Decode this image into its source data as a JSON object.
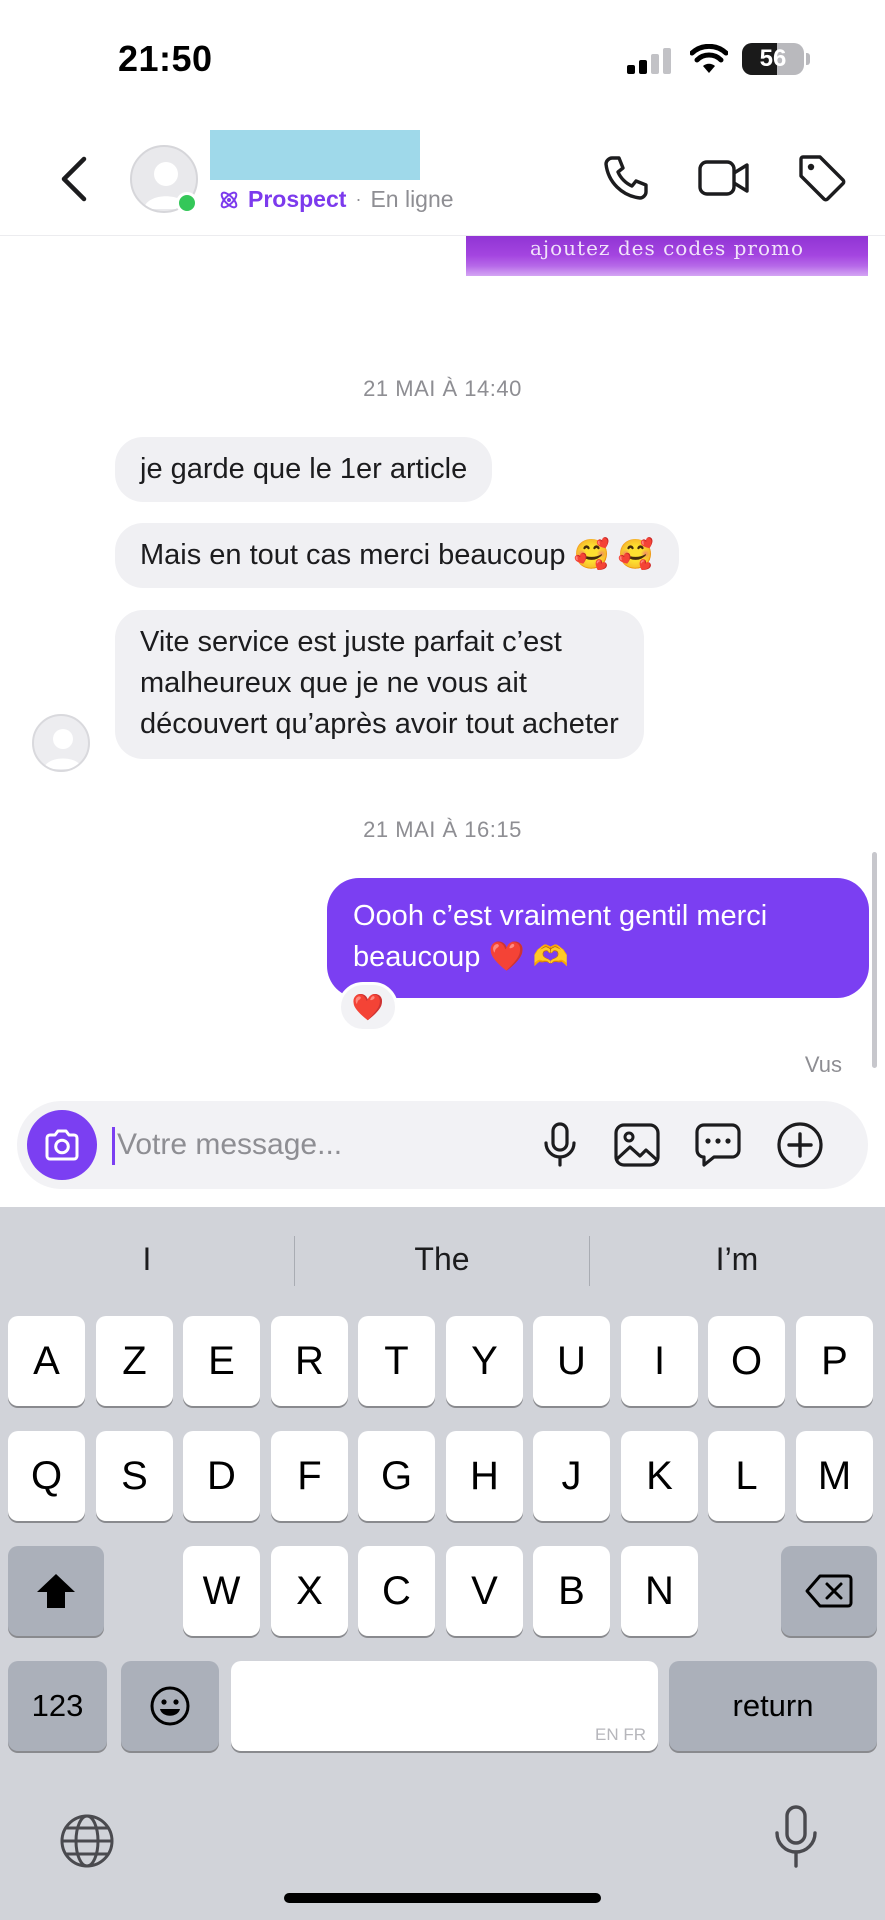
{
  "status_bar": {
    "time": "21:50",
    "battery_level": "56",
    "icons": [
      "cellular-signal-icon",
      "wifi-icon",
      "battery-icon"
    ]
  },
  "header": {
    "back_icon": "chevron-left-icon",
    "contact_tag": "Prospect",
    "separator": "·",
    "presence": "En ligne",
    "presence_color": "#34c759",
    "tag_color": "#7c3aed",
    "actions": [
      "phone-icon",
      "video-call-icon",
      "tag-icon"
    ]
  },
  "chat": {
    "media_preview_text": "ajoutez des codes promo",
    "groups": [
      {
        "timestamp": "21 MAI À 14:40",
        "direction": "incoming",
        "messages": [
          "je garde que le 1er article",
          "Mais en tout cas merci beaucoup 🥰 🥰",
          [
            "Vite service est juste parfait c’est",
            "malheureux que je ne vous ait",
            "découvert qu’après avoir tout acheter"
          ]
        ]
      },
      {
        "timestamp": "21 MAI À 16:15",
        "direction": "outgoing",
        "messages": [
          [
            "Oooh c’est vraiment gentil merci",
            "beaucoup ❤️ 🫶"
          ]
        ],
        "reaction": "❤️"
      }
    ],
    "seen_label": "Vus",
    "outgoing_color": "#7b3ff2",
    "incoming_color": "#f0f0f3"
  },
  "composer": {
    "placeholder": "Votre message...",
    "value": "",
    "icons": [
      "camera-icon",
      "microphone-icon",
      "image-icon",
      "quick-reply-icon",
      "add-icon"
    ]
  },
  "keyboard": {
    "suggestions": [
      "I",
      "The",
      "I’m"
    ],
    "rows": [
      [
        "A",
        "Z",
        "E",
        "R",
        "T",
        "Y",
        "U",
        "I",
        "O",
        "P"
      ],
      [
        "Q",
        "S",
        "D",
        "F",
        "G",
        "H",
        "J",
        "K",
        "L",
        "M"
      ],
      [
        "W",
        "X",
        "C",
        "V",
        "B",
        "N"
      ]
    ],
    "numbers_label": "123",
    "space_language_hint": "EN FR",
    "return_label": "return",
    "icons": [
      "shift-icon",
      "backspace-icon",
      "emoji-icon",
      "globe-icon",
      "dictation-icon"
    ]
  }
}
